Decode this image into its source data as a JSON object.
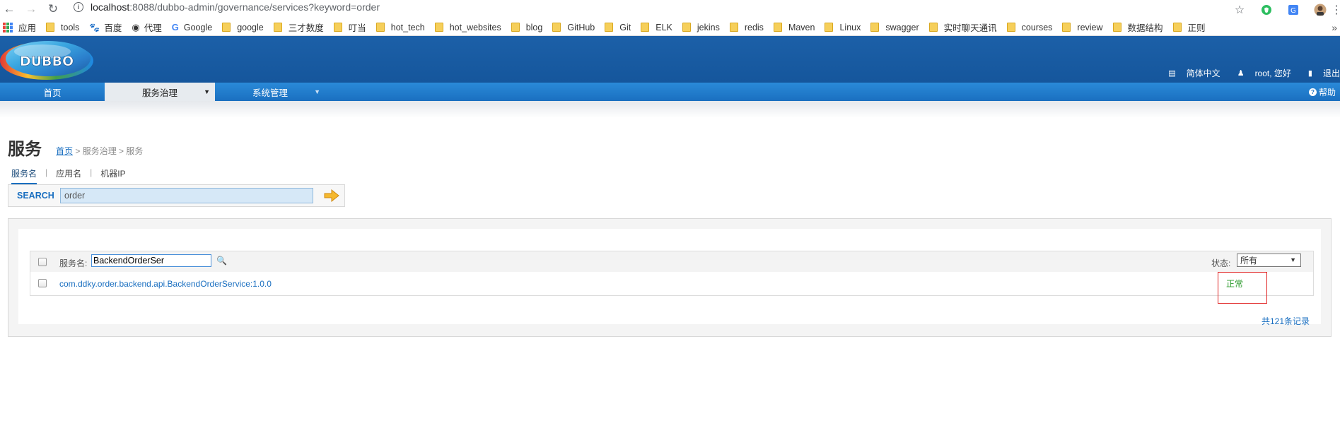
{
  "browser": {
    "url_host": "localhost",
    "url_rest": ":8088/dubbo-admin/governance/services?keyword=order",
    "bookmarks": [
      {
        "label": "应用",
        "type": "apps"
      },
      {
        "label": "tools",
        "type": "folder"
      },
      {
        "label": "百度",
        "type": "baidu"
      },
      {
        "label": "代理",
        "type": "globe"
      },
      {
        "label": "Google",
        "type": "google"
      },
      {
        "label": "google",
        "type": "folder"
      },
      {
        "label": "三才数度",
        "type": "folder"
      },
      {
        "label": "叮当",
        "type": "folder"
      },
      {
        "label": "hot_tech",
        "type": "folder"
      },
      {
        "label": "hot_websites",
        "type": "folder"
      },
      {
        "label": "blog",
        "type": "folder"
      },
      {
        "label": "GitHub",
        "type": "folder"
      },
      {
        "label": "Git",
        "type": "folder"
      },
      {
        "label": "ELK",
        "type": "folder"
      },
      {
        "label": "jekins",
        "type": "folder"
      },
      {
        "label": "redis",
        "type": "folder"
      },
      {
        "label": "Maven",
        "type": "folder"
      },
      {
        "label": "Linux",
        "type": "folder"
      },
      {
        "label": "swagger",
        "type": "folder"
      },
      {
        "label": "实时聊天通讯",
        "type": "folder"
      },
      {
        "label": "courses",
        "type": "folder"
      },
      {
        "label": "review",
        "type": "folder"
      },
      {
        "label": "数据结构",
        "type": "folder"
      },
      {
        "label": "正则",
        "type": "folder"
      }
    ],
    "more": "»"
  },
  "header": {
    "logo_text": "DUBBO",
    "lang": "简体中文",
    "user": "root, 您好",
    "logout": "退出"
  },
  "nav": {
    "home": "首页",
    "governance": "服务治理",
    "system": "系统管理",
    "help": "帮助"
  },
  "page": {
    "title": "服务",
    "breadcrumb_home": "首页",
    "breadcrumb_rest": " > 服务治理 > 服务",
    "tabs": [
      "服务名",
      "应用名",
      "机器IP"
    ],
    "search_label": "SEARCH",
    "search_value": "order"
  },
  "list": {
    "service_label": "服务名:",
    "service_filter": "BackendOrderSer",
    "status_label": "状态:",
    "status_value": "所有",
    "rows": [
      {
        "service": "com.ddky.order.backend.api.BackendOrderService:1.0.0",
        "status": "正常"
      }
    ],
    "total": "共121条记录"
  }
}
